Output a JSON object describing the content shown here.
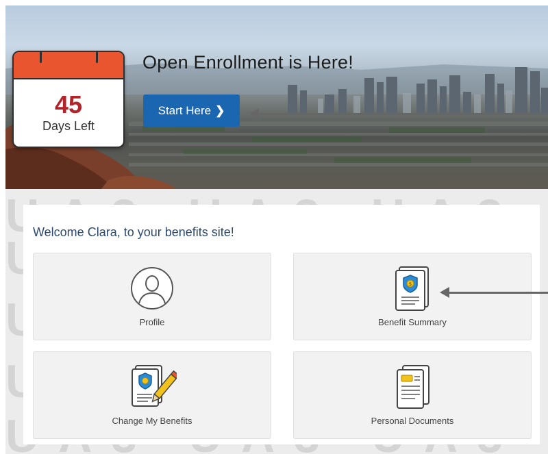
{
  "hero": {
    "title": "Open Enrollment is Here!",
    "start_button_label": "Start Here",
    "start_button_chevron": "❯",
    "calendar": {
      "number": "45",
      "label": "Days Left"
    }
  },
  "watermark_text": "UA3 UA3 UA3 UA3 UA3",
  "panel": {
    "welcome": "Welcome Clara, to your benefits site!",
    "tiles": [
      {
        "label": "Profile",
        "icon": "profile-icon"
      },
      {
        "label": "Benefit Summary",
        "icon": "benefit-summary-icon"
      },
      {
        "label": "Change My Benefits",
        "icon": "change-benefits-icon"
      },
      {
        "label": "Personal Documents",
        "icon": "personal-documents-icon"
      }
    ]
  },
  "colors": {
    "button_blue": "#1a66b1",
    "calendar_red": "#e8552f",
    "days_number_red": "#b3242a",
    "welcome_navy": "#2c4a6e",
    "shield_blue": "#2a8bd6",
    "coin_yellow": "#f1c21b"
  }
}
